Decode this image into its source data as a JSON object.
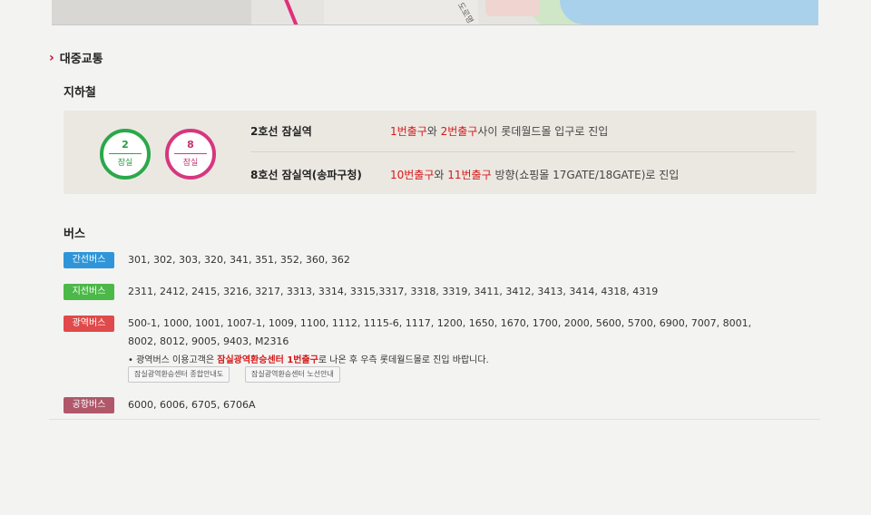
{
  "map": {
    "road_label": "도로명"
  },
  "section": {
    "title": "대중교통"
  },
  "subway": {
    "title": "지하철",
    "lines": [
      {
        "number": "2",
        "station": "잠실",
        "color": "#2aa84a"
      },
      {
        "number": "8",
        "station": "잠실",
        "color": "#d6377e"
      }
    ],
    "rows": [
      {
        "name": "2호선 잠실역",
        "exit_a": "1번출구",
        "conj": "와 ",
        "exit_b": "2번출구",
        "rest": "사이 롯데월드몰 입구로 진입"
      },
      {
        "name": "8호선 잠실역(송파구청)",
        "exit_a": "10번출구",
        "conj": "와 ",
        "exit_b": "11번출구",
        "rest": " 방향(쇼핑몰 17GATE/18GATE)로 진입"
      }
    ]
  },
  "bus": {
    "title": "버스",
    "rows": [
      {
        "badge": "간선버스",
        "color": "#2f95d8",
        "numbers": "301, 302, 303, 320, 341, 351, 352, 360, 362"
      },
      {
        "badge": "지선버스",
        "color": "#4cb848",
        "numbers": "2311, 2412, 2415, 3216, 3217, 3313, 3314, 3315,3317, 3318, 3319, 3411, 3412, 3413, 3414, 4318, 4319"
      },
      {
        "badge": "광역버스",
        "color": "#e04a4a",
        "numbers": "500-1, 1000, 1001, 1007-1, 1009, 1100, 1112, 1115-6, 1117, 1200, 1650, 1670, 1700, 2000, 5600, 5700, 6900, 7007, 8001,",
        "numbers_line2": "8002, 8012, 9005, 9403, M2316",
        "note_prefix": "• 광역버스 이용고객은 ",
        "note_highlight": "잠실광역환승센터 1번출구",
        "note_suffix": "로 나온 후 우측 롯데월드몰로 진입 바랍니다.",
        "buttons": [
          "잠실광역환승센터 종합안내도",
          "잠실광역환승센터 노선안내"
        ]
      },
      {
        "badge": "공항버스",
        "color": "#b0576a",
        "numbers": "6000, 6006, 6705, 6706A"
      }
    ]
  }
}
